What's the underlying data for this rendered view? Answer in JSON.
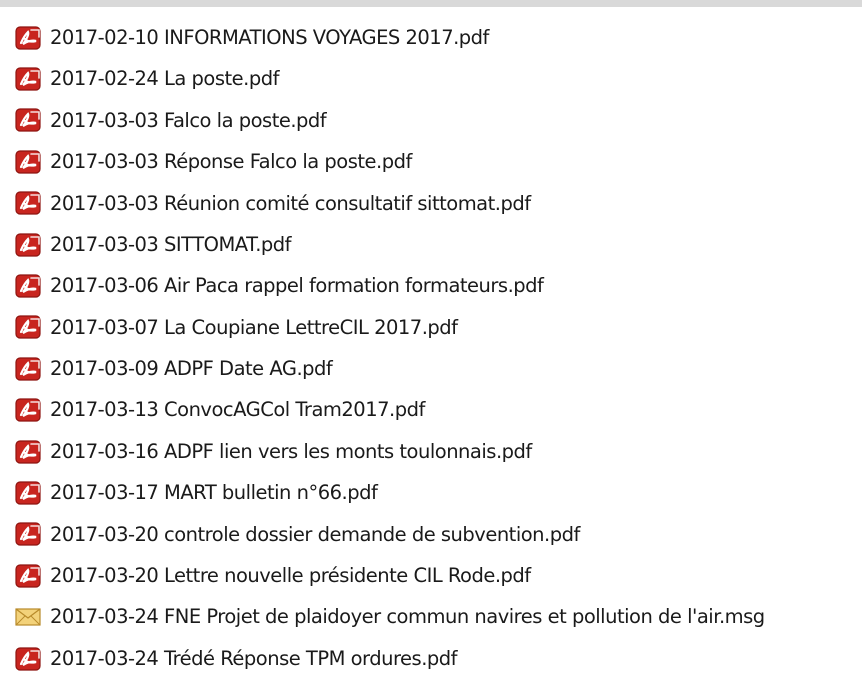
{
  "files": [
    {
      "name": "2017-02-10 INFORMATIONS VOYAGES 2017.pdf",
      "icon": "pdf-icon"
    },
    {
      "name": "2017-02-24 La poste.pdf",
      "icon": "pdf-icon"
    },
    {
      "name": "2017-03-03 Falco la poste.pdf",
      "icon": "pdf-icon"
    },
    {
      "name": "2017-03-03 Réponse Falco la poste.pdf",
      "icon": "pdf-icon"
    },
    {
      "name": "2017-03-03 Réunion comité consultatif sittomat.pdf",
      "icon": "pdf-icon"
    },
    {
      "name": "2017-03-03 SITTOMAT.pdf",
      "icon": "pdf-icon"
    },
    {
      "name": "2017-03-06 Air Paca rappel formation formateurs.pdf",
      "icon": "pdf-icon"
    },
    {
      "name": "2017-03-07 La Coupiane LettreCIL 2017.pdf",
      "icon": "pdf-icon"
    },
    {
      "name": "2017-03-09 ADPF Date AG.pdf",
      "icon": "pdf-icon"
    },
    {
      "name": "2017-03-13 ConvocAGCol Tram2017.pdf",
      "icon": "pdf-icon"
    },
    {
      "name": "2017-03-16 ADPF lien vers les monts toulonnais.pdf",
      "icon": "pdf-icon"
    },
    {
      "name": "2017-03-17 MART bulletin n°66.pdf",
      "icon": "pdf-icon"
    },
    {
      "name": "2017-03-20 controle dossier demande de subvention.pdf",
      "icon": "pdf-icon"
    },
    {
      "name": "2017-03-20 Lettre nouvelle présidente CIL Rode.pdf",
      "icon": "pdf-icon"
    },
    {
      "name": "2017-03-24 FNE Projet de plaidoyer commun navires et pollution de l'air.msg",
      "icon": "mail-icon"
    },
    {
      "name": "2017-03-24 Trédé Réponse TPM ordures.pdf",
      "icon": "pdf-icon"
    }
  ],
  "colors": {
    "pdf_icon_red": "#c8251f",
    "pdf_icon_dark": "#8e1510",
    "mail_icon_fill": "#f3d27a",
    "mail_icon_stroke": "#b88a2a",
    "text": "#1a1a1a",
    "border": "#d9d9d9"
  }
}
